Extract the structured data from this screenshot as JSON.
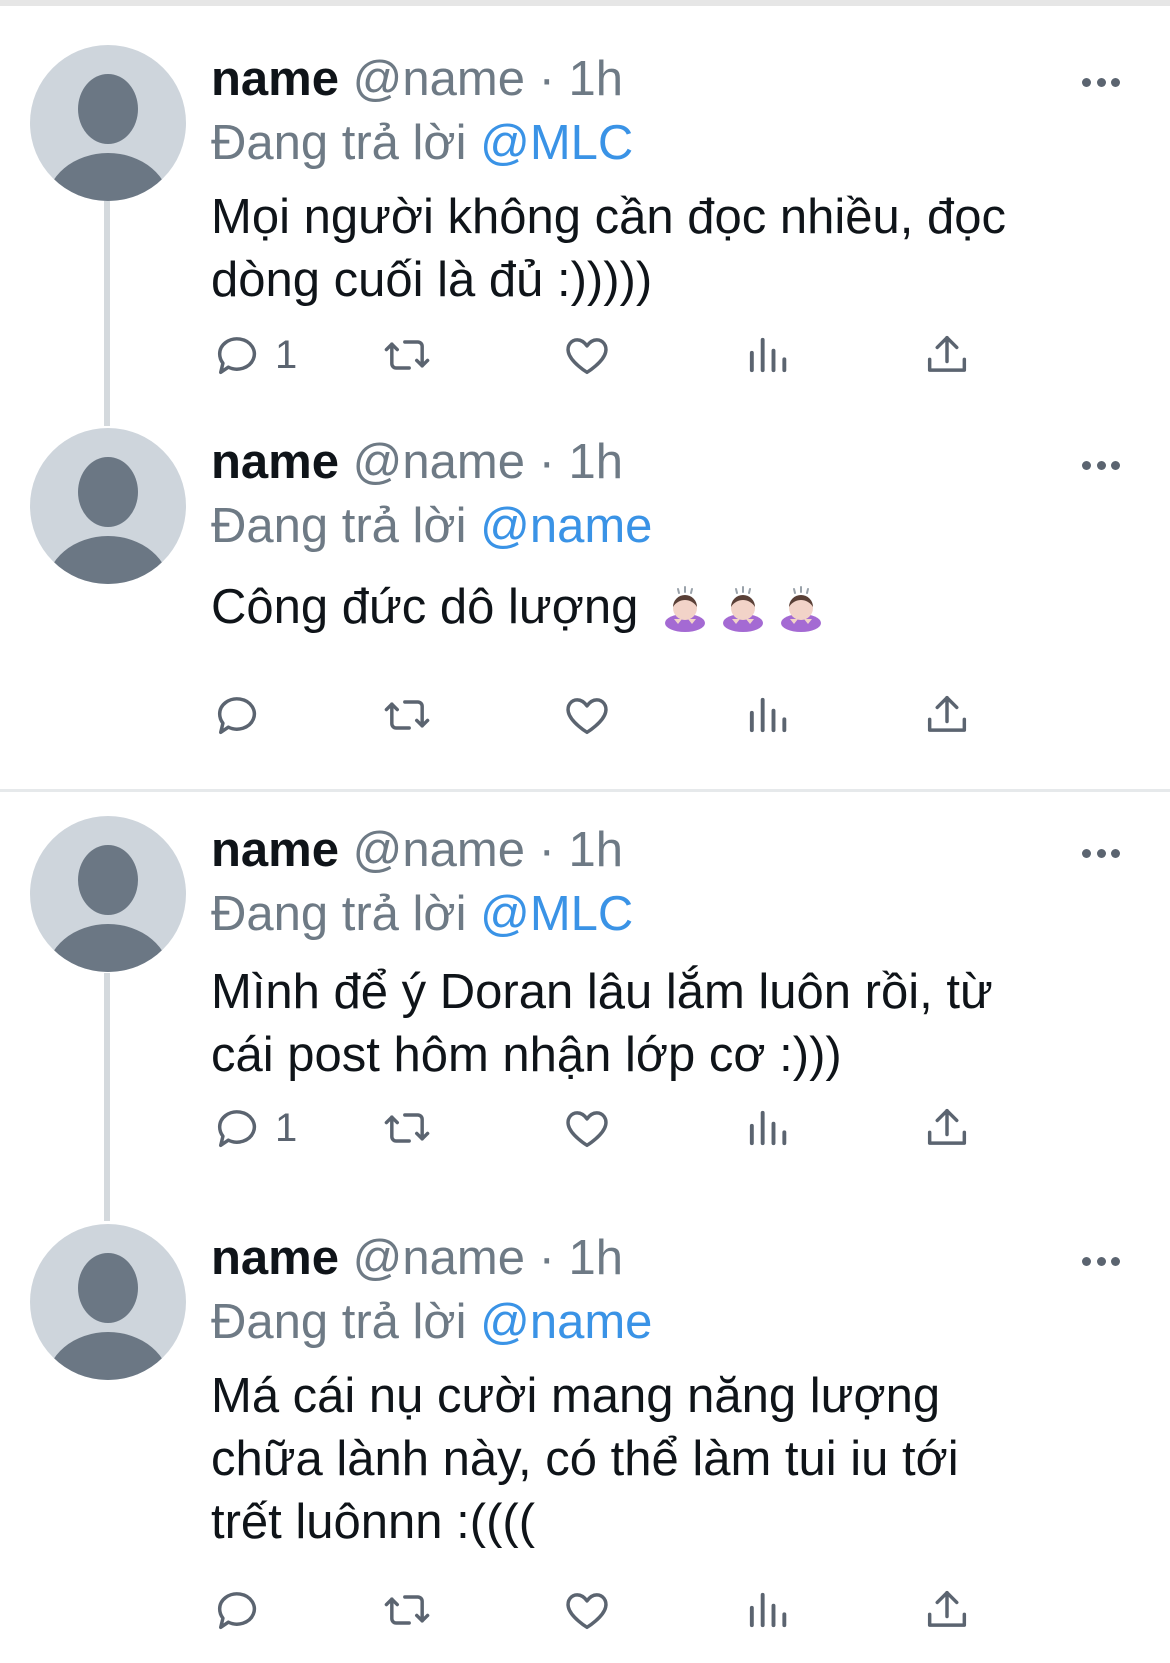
{
  "tweets": [
    {
      "name": "name",
      "handle": "@name",
      "separator": " · ",
      "time": "1h",
      "reply_prefix": "Đang trả lời ",
      "reply_to": "@MLC",
      "lines": [
        "Mọi người không cần đọc nhiều, đọc",
        "dòng cuối là đủ :)))))"
      ],
      "reply_count": "1"
    },
    {
      "name": "name",
      "handle": "@name",
      "separator": " · ",
      "time": "1h",
      "reply_prefix": "Đang trả lời ",
      "reply_to": "@name",
      "lines": [
        "Công đức dô lượng"
      ],
      "emoji": [
        "person-bowing-emoji",
        "person-bowing-emoji",
        "person-bowing-emoji"
      ],
      "reply_count": ""
    },
    {
      "name": "name",
      "handle": "@name",
      "separator": " · ",
      "time": "1h",
      "reply_prefix": "Đang trả lời ",
      "reply_to": "@MLC",
      "lines": [
        "Mình để ý Doran lâu lắm luôn rồi, từ",
        "cái post hôm nhận lớp cơ :)))"
      ],
      "reply_count": "1"
    },
    {
      "name": "name",
      "handle": "@name",
      "separator": " · ",
      "time": "1h",
      "reply_prefix": "Đang trả lời ",
      "reply_to": "@name",
      "lines": [
        "Má cái nụ cười mang năng lượng",
        "chữa lành này, có thể làm tui iu tới",
        "trết luônnn :(((("
      ],
      "reply_count": ""
    }
  ],
  "colors": {
    "name": "#0f1419",
    "meta": "#6e7a85",
    "mention": "#3a93e6",
    "avatar_bg": "#ced5dc",
    "avatar_fg": "#6b7784",
    "thread_line": "#d4d9dd"
  },
  "icons": [
    "reply-icon",
    "retweet-icon",
    "like-icon",
    "views-icon",
    "share-icon",
    "more-icon"
  ]
}
